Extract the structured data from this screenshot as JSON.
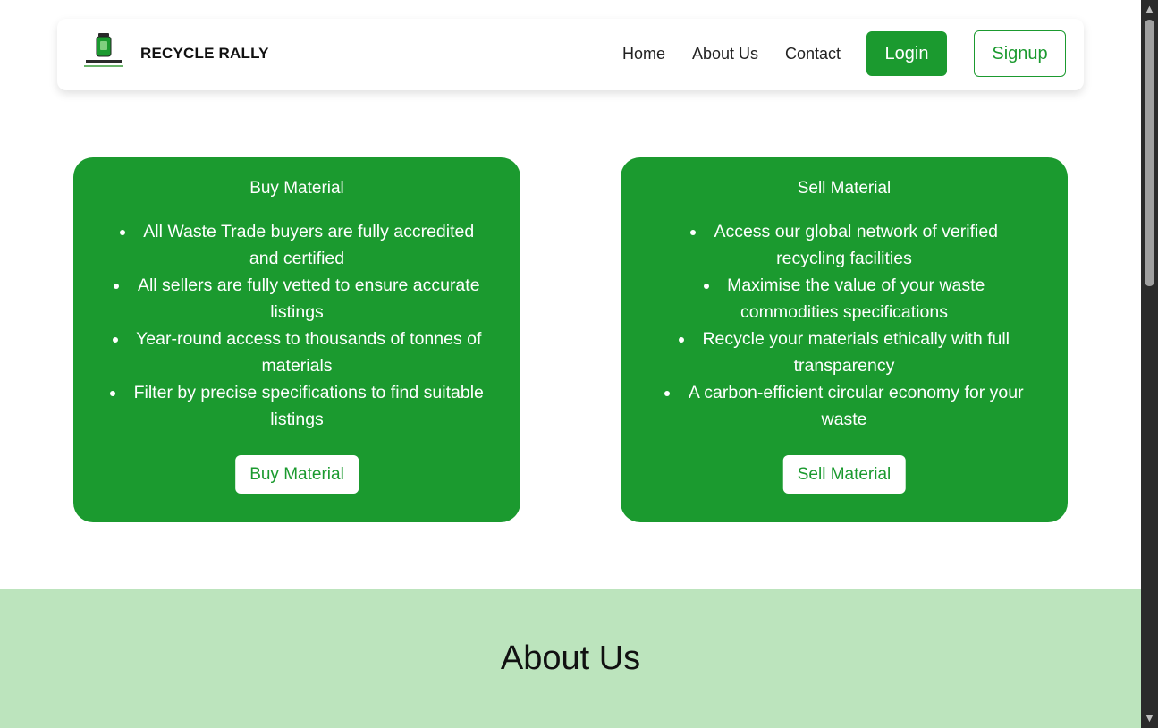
{
  "navbar": {
    "brand": "RECYCLE RALLY",
    "logo_icon": "recycle-bin-logo",
    "links": [
      "Home",
      "About Us",
      "Contact"
    ],
    "login_label": "Login",
    "signup_label": "Signup"
  },
  "cards": {
    "buy": {
      "title": "Buy Material",
      "items": [
        "All Waste Trade buyers are fully accredited and certified",
        "All sellers are fully vetted to ensure accurate listings",
        "Year-round access to thousands of tonnes of materials",
        "Filter by precise specifications to find suitable listings"
      ],
      "button_label": "Buy Material"
    },
    "sell": {
      "title": "Sell Material",
      "items": [
        "Access our global network of verified recycling facilities",
        "Maximise the value of your waste commodities specifications",
        "Recycle your materials ethically with full transparency",
        "A carbon-efficient circular economy for your waste"
      ],
      "button_label": "Sell Material"
    }
  },
  "about": {
    "title": "About Us"
  },
  "colors": {
    "brand_green": "#1b9a2f",
    "about_bg": "#bce4bd"
  }
}
